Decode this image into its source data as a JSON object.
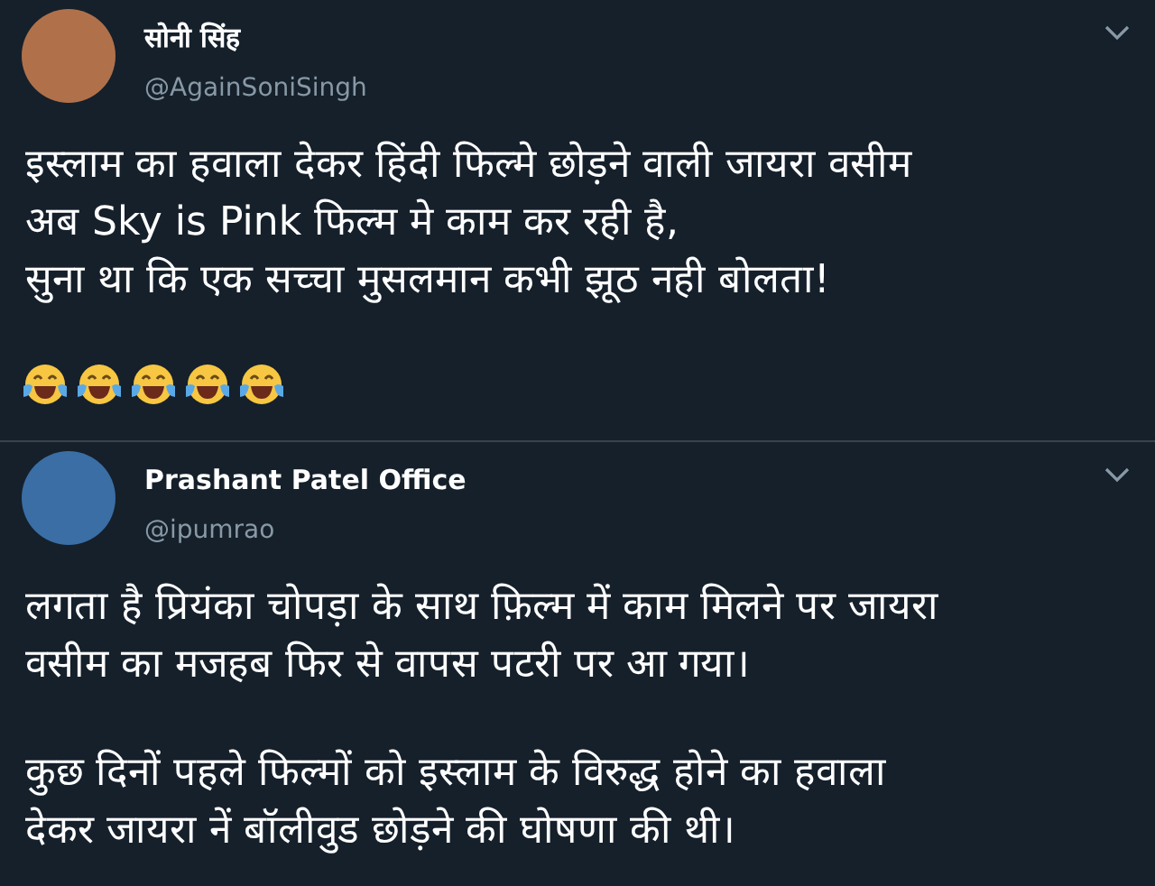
{
  "tweets": [
    {
      "name": "सोनी सिंह",
      "handle": "@AgainSoniSingh",
      "paragraphs": [
        "इस्लाम का हवाला देकर हिंदी फिल्मे छोड़ने वाली जायरा वसीम\nअब Sky is Pink फिल्म मे काम कर रही है,\nसुना था कि एक सच्चा मुसलमान कभी झूठ नही बोलता!"
      ],
      "emojis": [
        {
          "kind": "tears-of-joy"
        },
        {
          "kind": "tears-of-joy"
        },
        {
          "kind": "tears-of-joy"
        },
        {
          "kind": "tears-of-joy"
        },
        {
          "kind": "tears-of-joy"
        }
      ]
    },
    {
      "name": "Prashant Patel Office",
      "handle": "@ipumrao",
      "paragraphs": [
        "लगता है प्रियंका चोपड़ा के साथ फ़िल्म में काम मिलने पर जायरा\nवसीम का मजहब फिर से वापस पटरी पर आ गया।",
        "कुछ दिनों पहले फिल्मों को इस्लाम के विरुद्ध होने का हवाला\nदेकर जायरा नें बॉलीवुड छोड़ने की घोषणा की थी।"
      ]
    }
  ]
}
